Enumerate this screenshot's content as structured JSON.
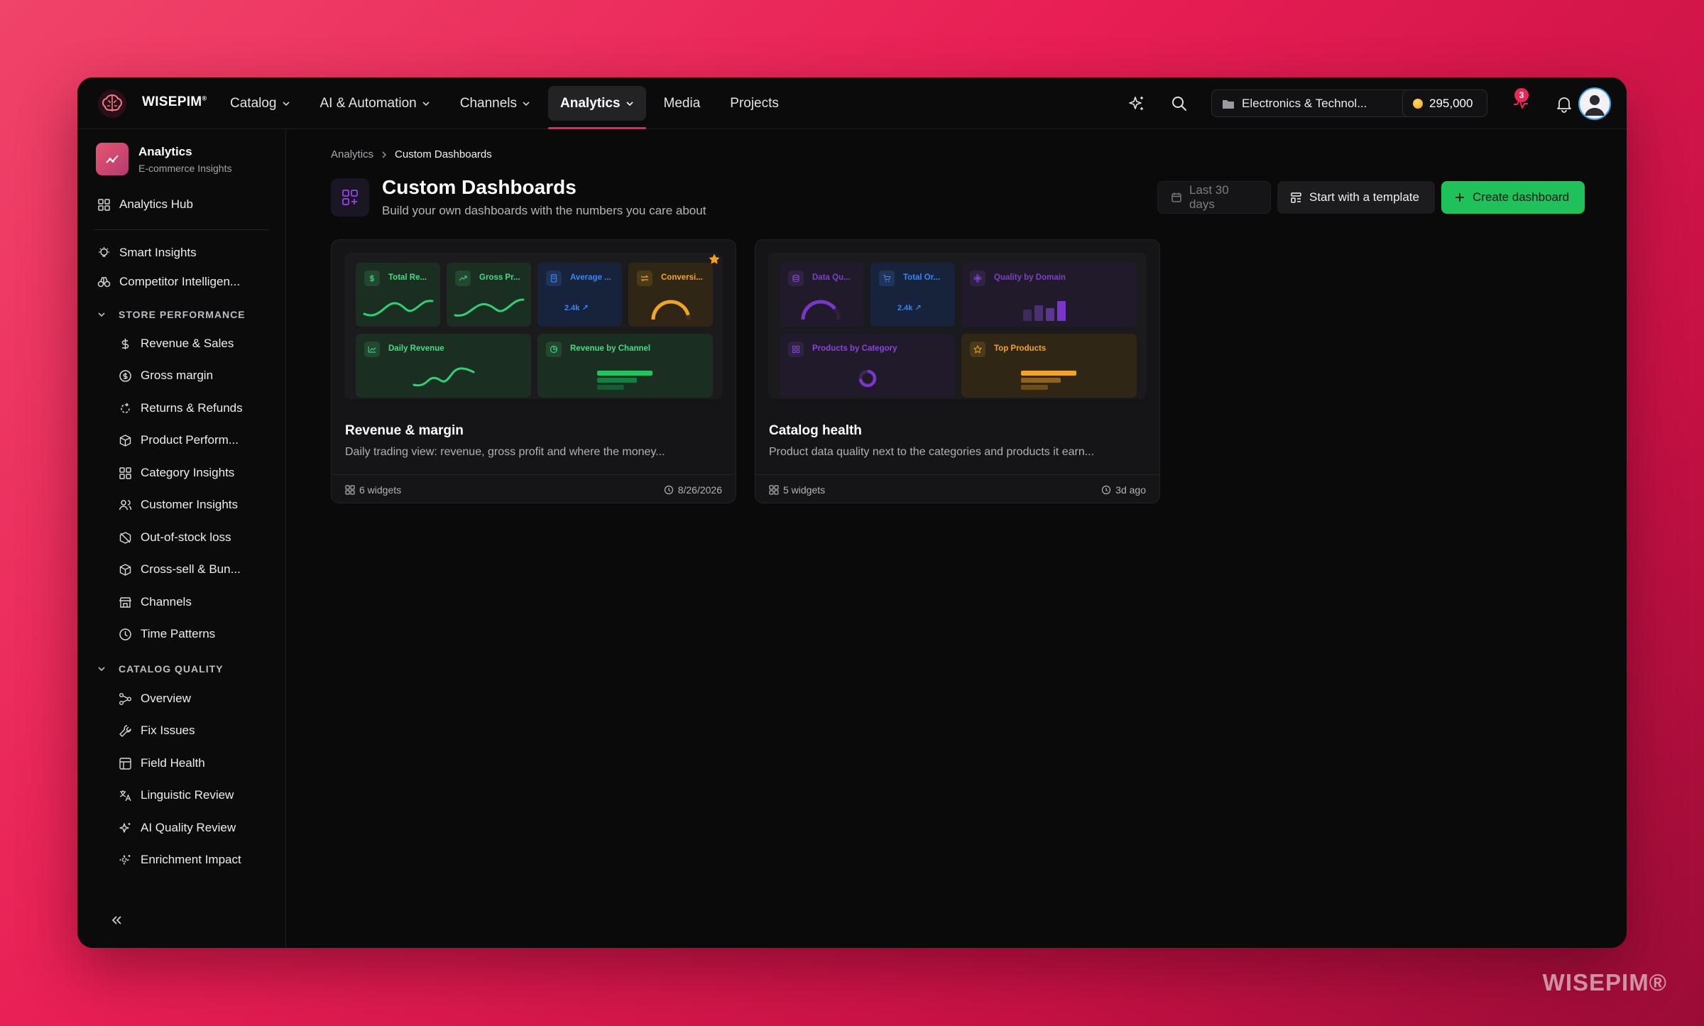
{
  "topbar": {
    "brand": "WISEPIM",
    "brand_mark": "®",
    "nav": [
      {
        "label": "Catalog",
        "has_dropdown": true
      },
      {
        "label": "AI & Automation",
        "has_dropdown": true
      },
      {
        "label": "Channels",
        "has_dropdown": true
      },
      {
        "label": "Analytics",
        "has_dropdown": true,
        "active": true
      },
      {
        "label": "Media",
        "has_dropdown": false
      },
      {
        "label": "Projects",
        "has_dropdown": false
      }
    ],
    "org_selector": "Electronics & Technol...",
    "credits": "295,000",
    "notification_count": "3"
  },
  "sidebar": {
    "header_title": "Analytics",
    "header_subtitle": "E-commerce Insights",
    "hub": "Analytics Hub",
    "top_items": [
      "Smart Insights",
      "Competitor Intelligen..."
    ],
    "section_store": "STORE PERFORMANCE",
    "store_items": [
      "Revenue & Sales",
      "Gross margin",
      "Returns & Refunds",
      "Product Perform...",
      "Category Insights",
      "Customer Insights",
      "Out-of-stock loss",
      "Cross-sell & Bun...",
      "Channels",
      "Time Patterns"
    ],
    "section_catalog": "CATALOG QUALITY",
    "catalog_items": [
      "Overview",
      "Fix Issues",
      "Field Health",
      "Linguistic Review",
      "AI Quality Review",
      "Enrichment Impact"
    ]
  },
  "main": {
    "breadcrumb_root": "Analytics",
    "breadcrumb_current": "Custom Dashboards",
    "title": "Custom Dashboards",
    "subtitle": "Build your own dashboards with the numbers you care about",
    "date_range": "Last 30 days",
    "template_button": "Start with a template",
    "create_button": "Create dashboard",
    "cards": [
      {
        "title": "Revenue & margin",
        "description": "Daily trading view: revenue, gross profit and where the money...",
        "widgets": "6 widgets",
        "updated": "8/26/2026",
        "favorite": true,
        "widget_labels": [
          "Total Re...",
          "Gross Pr...",
          "Average ...",
          "Conversi...",
          "Daily Revenue",
          "Revenue by Channel"
        ],
        "kpi_value": "2.4k"
      },
      {
        "title": "Catalog health",
        "description": "Product data quality next to the categories and products it earn...",
        "widgets": "5 widgets",
        "updated": "3d ago",
        "favorite": false,
        "widget_labels": [
          "Data Qu...",
          "Total Or...",
          "Quality by Domain",
          "Products by Category",
          "Top Products"
        ],
        "kpi_value": "2.4k"
      }
    ]
  },
  "watermark": "WISEPIM®",
  "colors": {
    "accent": "#e8265a",
    "primary_button": "#1fc25a",
    "background": "#0a0a0b"
  }
}
